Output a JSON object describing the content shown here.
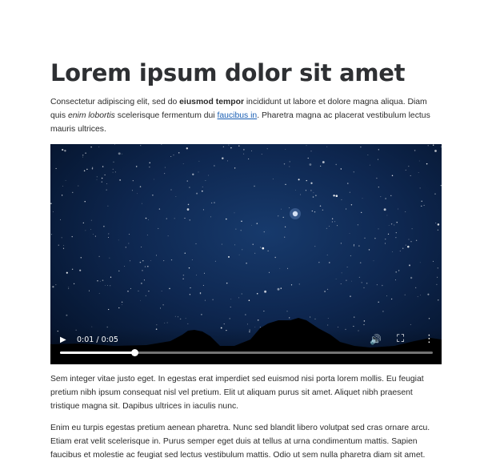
{
  "article": {
    "title": "Lorem ipsum dolor sit amet",
    "intro": {
      "t1": "Consectetur adipiscing elit, sed do ",
      "bold": "eiusmod tempor",
      "t2": " incididunt ut labore et dolore magna aliqua. Diam quis ",
      "italic": "enim lobortis",
      "t3": " scelerisque fermentum dui ",
      "link": "faucibus in",
      "t4": ". Pharetra magna ac placerat vestibulum lectus mauris ultrices."
    },
    "para2": "Sem integer vitae justo eget. In egestas erat imperdiet sed euismod nisi porta lorem mollis. Eu feugiat pretium nibh ipsum consequat nisl vel pretium. Elit ut aliquam purus sit amet. Aliquet nibh praesent tristique magna sit. Dapibus ultrices in iaculis nunc.",
    "para3": "Enim eu turpis egestas pretium aenean pharetra. Nunc sed blandit libero volutpat sed cras ornare arcu. Etiam erat velit scelerisque in. Purus semper eget duis at tellus at urna condimentum mattis. Sapien faucibus et molestie ac feugiat sed lectus vestibulum mattis. Odio ut sem nulla pharetra diam sit amet."
  },
  "video": {
    "time_display": "0:01 / 0:05",
    "progress_fraction": 0.2,
    "icons": {
      "play": "play-icon",
      "volume": "volume-icon",
      "fullscreen": "fullscreen-icon",
      "more": "more-options-icon"
    }
  }
}
